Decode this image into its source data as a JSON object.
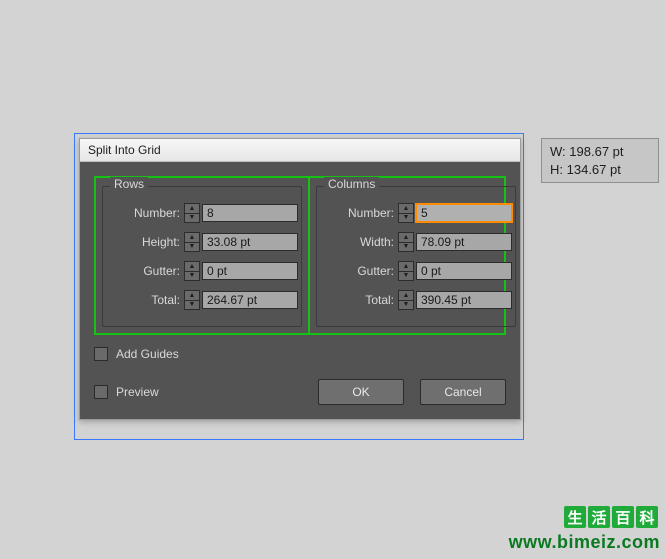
{
  "dialog": {
    "title": "Split Into Grid",
    "rows": {
      "legend": "Rows",
      "number_label": "Number:",
      "number_value": "8",
      "height_label": "Height:",
      "height_value": "33.08 pt",
      "gutter_label": "Gutter:",
      "gutter_value": "0 pt",
      "total_label": "Total:",
      "total_value": "264.67 pt"
    },
    "columns": {
      "legend": "Columns",
      "number_label": "Number:",
      "number_value": "5",
      "width_label": "Width:",
      "width_value": "78.09 pt",
      "gutter_label": "Gutter:",
      "gutter_value": "0 pt",
      "total_label": "Total:",
      "total_value": "390.45 pt"
    },
    "add_guides_label": "Add Guides",
    "preview_label": "Preview",
    "ok_label": "OK",
    "cancel_label": "Cancel"
  },
  "info": {
    "w_label": "W:",
    "w_value": "198.67 pt",
    "h_label": "H:",
    "h_value": "134.67 pt"
  },
  "watermark": {
    "chars": [
      "生",
      "活",
      "百",
      "科"
    ],
    "url": "www.bimeiz.com"
  }
}
